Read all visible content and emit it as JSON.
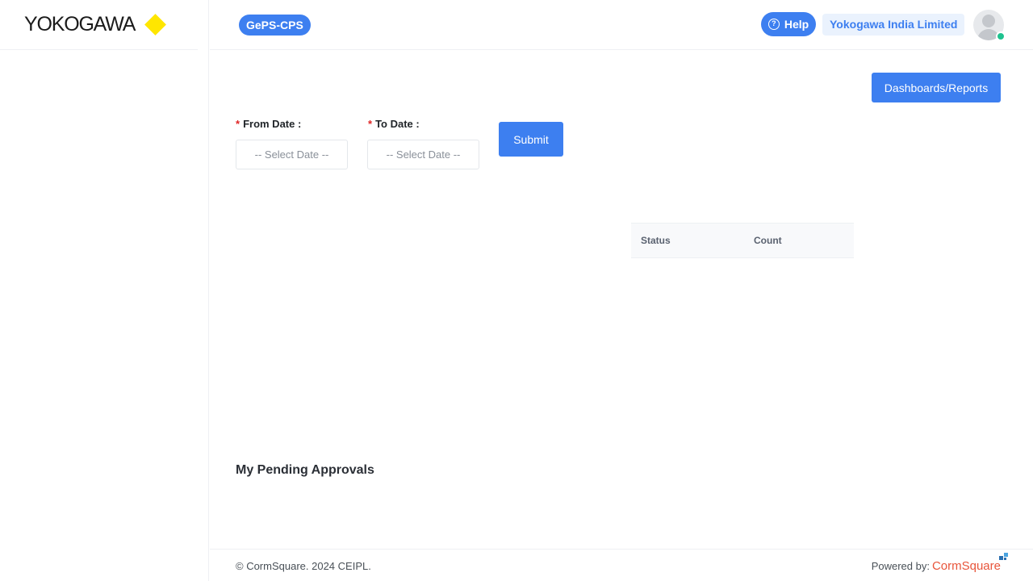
{
  "brand": {
    "logo_text": "YOKOGAWA",
    "logo_color": "#ffe600"
  },
  "header": {
    "app_badge": "GePS-CPS",
    "help_label": "Help",
    "help_icon_glyph": "?",
    "company": "Yokogawa India Limited",
    "accent_color": "#3d7ff0",
    "online_status_color": "#1fc28f"
  },
  "main": {
    "dashboards_button": "Dashboards/Reports",
    "from_date": {
      "required_mark": "*",
      "label": "From Date :",
      "placeholder": "-- Select Date --"
    },
    "to_date": {
      "required_mark": "*",
      "label": "To Date :",
      "placeholder": "-- Select Date --"
    },
    "submit_button": "Submit",
    "status_table": {
      "columns": [
        "Status",
        "Count"
      ],
      "rows": []
    },
    "pending_approvals_title": "My Pending Approvals"
  },
  "footer": {
    "copyright": "© CormSquare. 2024 CEIPL.",
    "powered_by_label": "Powered by:",
    "powered_by_brand": "CormSquare"
  }
}
